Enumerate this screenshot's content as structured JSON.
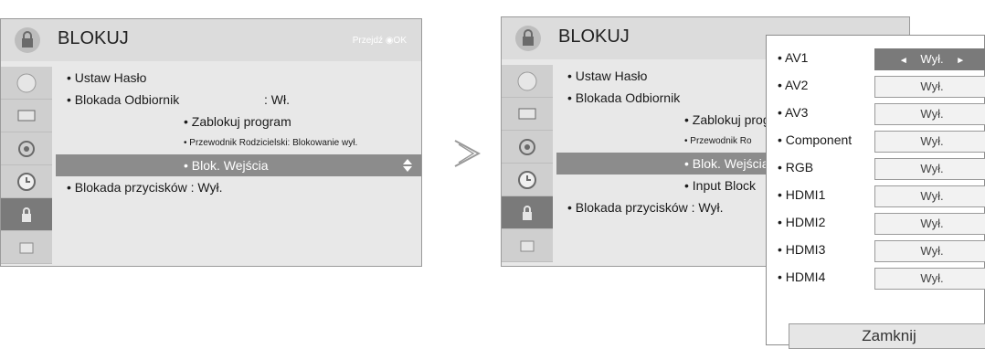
{
  "left_screen": {
    "title": "BLOKUJ",
    "nav_hint": "Przejdź  ◉OK",
    "items": [
      {
        "label": "Ustaw Hasło"
      },
      {
        "label": "Blokada Odbiornik",
        "value": ": Wł."
      },
      {
        "label": "Zablokuj program"
      },
      {
        "label": "Przewodnik Rodzicielski: Blokowanie wył."
      },
      {
        "label": "Blok. Wejścia"
      },
      {
        "label": "Blokada przycisków : Wył."
      }
    ]
  },
  "right_screen": {
    "title": "BLOKUJ",
    "items": [
      {
        "label": "Ustaw Hasło"
      },
      {
        "label": "Blokada Odbiornik"
      },
      {
        "label": "Zablokuj prog"
      },
      {
        "label": "Przewodnik  Ro"
      },
      {
        "label": "Blok. Wejścia"
      },
      {
        "label": "Input Block"
      },
      {
        "label": "Blokada przycisków : Wył."
      }
    ],
    "popup": {
      "inputs": [
        {
          "name": "AV1",
          "value": "Wył."
        },
        {
          "name": "AV2",
          "value": "Wył."
        },
        {
          "name": "AV3",
          "value": "Wył."
        },
        {
          "name": "Component",
          "value": "Wył."
        },
        {
          "name": "RGB",
          "value": "Wył."
        },
        {
          "name": "HDMI1",
          "value": "Wył."
        },
        {
          "name": "HDMI2",
          "value": "Wył."
        },
        {
          "name": "HDMI3",
          "value": "Wył."
        },
        {
          "name": "HDMI4",
          "value": "Wył."
        }
      ],
      "active_left_arrow": "◄",
      "active_right_arrow": "►",
      "close_label": "Zamknij"
    }
  },
  "icons": [
    "lock-icon",
    "picture-icon",
    "display-icon",
    "audio-icon",
    "clock-icon",
    "lock-icon",
    "option-icon",
    "select-arrow-icon"
  ],
  "colors": {
    "highlight": "#8c8c8c",
    "active_sidebar": "#7a7a7a",
    "panel": "#e8e8e8"
  }
}
